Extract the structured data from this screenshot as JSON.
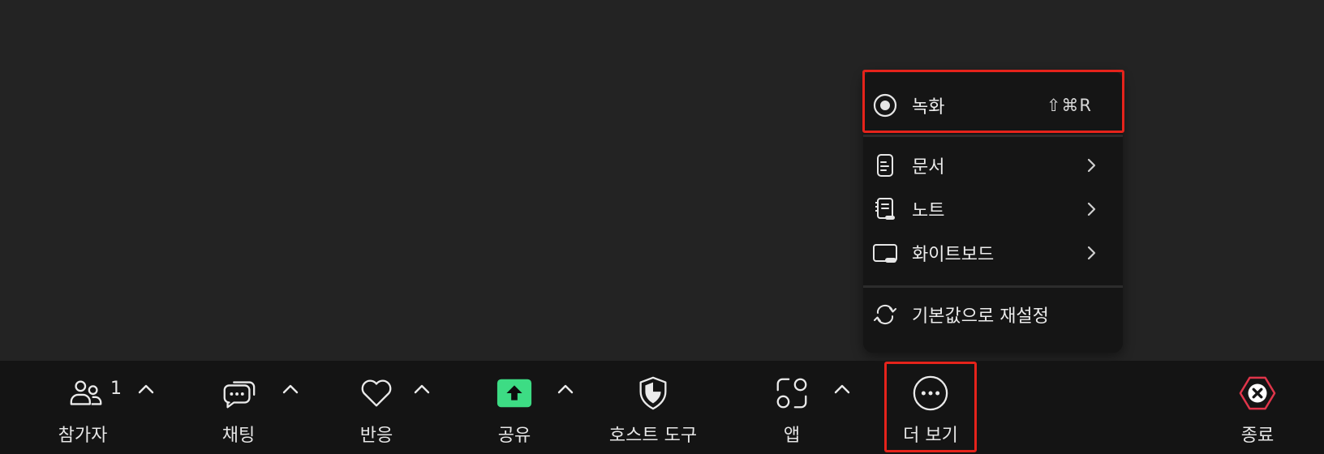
{
  "toolbar": {
    "participants": {
      "label": "참가자",
      "count": "1"
    },
    "chat": {
      "label": "채팅"
    },
    "reactions": {
      "label": "반응"
    },
    "share": {
      "label": "공유"
    },
    "host_tools": {
      "label": "호스트 도구"
    },
    "apps": {
      "label": "앱"
    },
    "more": {
      "label": "더 보기"
    },
    "end": {
      "label": "종료"
    }
  },
  "menu": {
    "record": {
      "label": "녹화",
      "shortcut": "⇧⌘R"
    },
    "items": [
      {
        "label": "문서",
        "icon": "document-icon"
      },
      {
        "label": "노트",
        "icon": "notes-icon"
      },
      {
        "label": "화이트보드",
        "icon": "whiteboard-icon"
      }
    ],
    "reset": {
      "label": "기본값으로 재설정"
    }
  },
  "colors": {
    "background": "#232323",
    "toolbar": "#141414",
    "menu": "#151515",
    "share_accent": "#3ddc84",
    "end_accent": "#e0354a",
    "highlight": "#e5231b"
  }
}
